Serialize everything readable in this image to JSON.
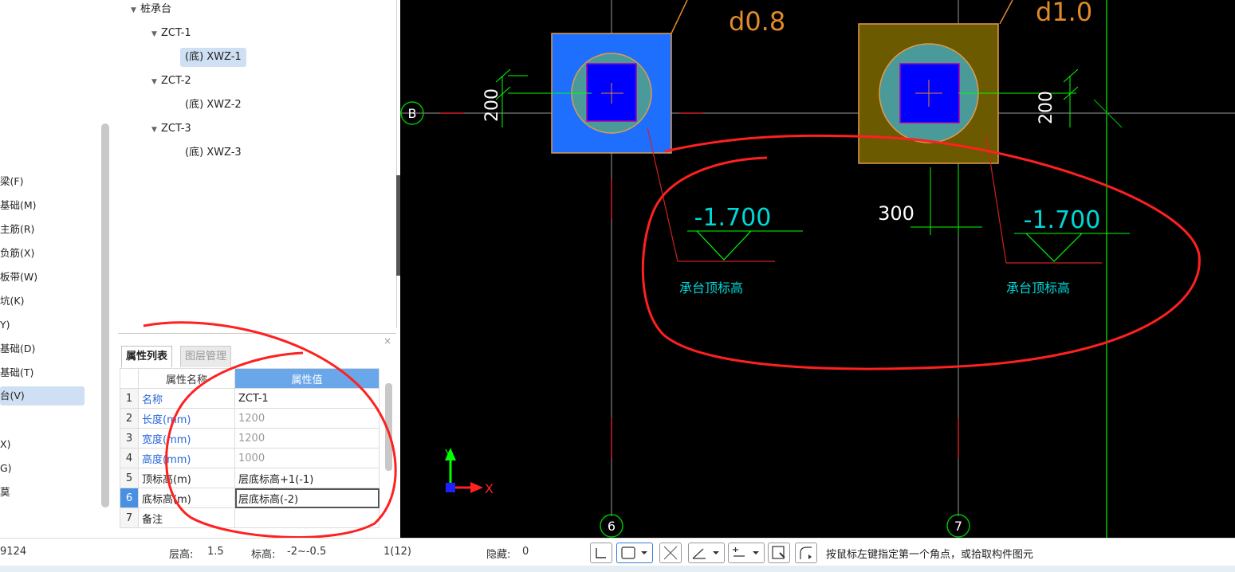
{
  "left_nav": {
    "items": [
      {
        "label": "梁(F)",
        "selected": false
      },
      {
        "label": "基础(M)",
        "selected": false
      },
      {
        "label": "主筋(R)",
        "selected": false
      },
      {
        "label": "负筋(X)",
        "selected": false
      },
      {
        "label": "板带(W)",
        "selected": false
      },
      {
        "label": "坑(K)",
        "selected": false
      },
      {
        "label": "Y)",
        "selected": false
      },
      {
        "label": "基础(D)",
        "selected": false
      },
      {
        "label": "基础(T)",
        "selected": false
      },
      {
        "label": "台(V)",
        "selected": true
      },
      {
        "label": "X)",
        "selected": false
      },
      {
        "label": "G)",
        "selected": false
      },
      {
        "label": "莫",
        "selected": false
      }
    ]
  },
  "tree": {
    "root": "桩承台",
    "groups": [
      {
        "label": "ZCT-1",
        "child": "(底) XWZ-1",
        "child_selected": true
      },
      {
        "label": "ZCT-2",
        "child": "(底) XWZ-2",
        "child_selected": false
      },
      {
        "label": "ZCT-3",
        "child": "(底) XWZ-3",
        "child_selected": false
      }
    ]
  },
  "properties": {
    "tab_active": "属性列表",
    "tab_inactive": "图层管理",
    "close": "×",
    "col_name": "属性名称",
    "col_value": "属性值",
    "rows": [
      {
        "n": "1",
        "name": "名称",
        "value": "ZCT-1"
      },
      {
        "n": "2",
        "name": "长度(mm)",
        "value": "1200"
      },
      {
        "n": "3",
        "name": "宽度(mm)",
        "value": "1200"
      },
      {
        "n": "4",
        "name": "高度(mm)",
        "value": "1000"
      },
      {
        "n": "5",
        "name": "顶标高(m)",
        "value": "层底标高+1(-1)"
      },
      {
        "n": "6",
        "name": "底标高(m)",
        "value": "层底标高(-2)"
      },
      {
        "n": "7",
        "name": "备注",
        "value": ""
      }
    ]
  },
  "canvas": {
    "axis_b": "B",
    "axis_6": "6",
    "axis_7": "7",
    "label_d08": "d0.8",
    "label_d10": "d1.0",
    "dim_200_left": "200",
    "dim_200_right": "200",
    "dim_300": "300",
    "elev_left": "-1.700",
    "elev_right": "-1.700",
    "note_left": "承台顶标高",
    "note_right": "承台顶标高",
    "ucs_x": "X",
    "ucs_y": "Y",
    "colors": {
      "background": "#000000",
      "cap_left": "#1f6fff",
      "cap_right": "#6b5a00",
      "pile": "#4a9a9a",
      "annot": "#00d8d8",
      "dim": "#00ff00",
      "label": "#e08a2a",
      "markup": "#ff2020"
    }
  },
  "status": {
    "coord": "9124",
    "floor_height_label": "层高:",
    "floor_height_value": "1.5",
    "elev_label": "标高:",
    "elev_value": "-2~-0.5",
    "count": "1(12)",
    "hidden_label": "隐藏:",
    "hidden_value": "0",
    "hint": "按鼠标左键指定第一个角点，或拾取构件图元"
  }
}
